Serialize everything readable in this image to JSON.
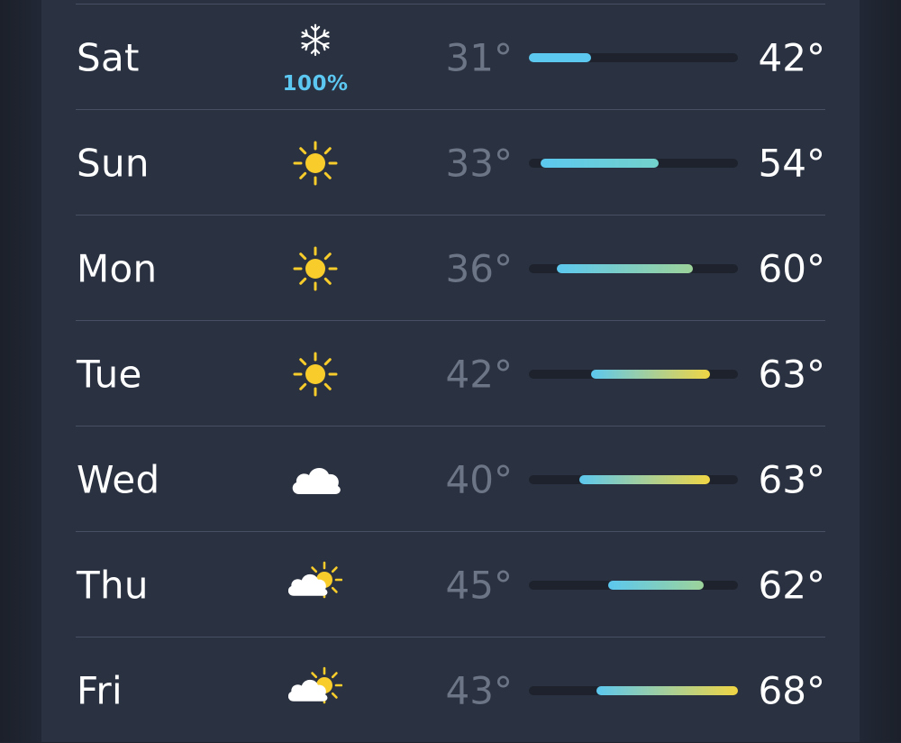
{
  "colors": {
    "precip_text": "#5cc8f2",
    "sun": "#f8cd2b",
    "cloud": "#ffffff",
    "low_temp_text": "#6c7585",
    "high_temp_text": "#ffffff",
    "track": "#1d222c"
  },
  "temperature_scale": {
    "min": 31,
    "max": 68
  },
  "forecast": [
    {
      "day": "Sat",
      "icon": "snowflake-icon",
      "precip": "100%",
      "low": "31°",
      "high": "42°",
      "low_value": 31,
      "high_value": 42
    },
    {
      "day": "Sun",
      "icon": "sun-icon",
      "precip": "",
      "low": "33°",
      "high": "54°",
      "low_value": 33,
      "high_value": 54
    },
    {
      "day": "Mon",
      "icon": "sun-icon",
      "precip": "",
      "low": "36°",
      "high": "60°",
      "low_value": 36,
      "high_value": 60
    },
    {
      "day": "Tue",
      "icon": "sun-icon",
      "precip": "",
      "low": "42°",
      "high": "63°",
      "low_value": 42,
      "high_value": 63
    },
    {
      "day": "Wed",
      "icon": "cloud-icon",
      "precip": "",
      "low": "40°",
      "high": "63°",
      "low_value": 40,
      "high_value": 63
    },
    {
      "day": "Thu",
      "icon": "partly-cloudy-icon",
      "precip": "",
      "low": "45°",
      "high": "62°",
      "low_value": 45,
      "high_value": 62
    },
    {
      "day": "Fri",
      "icon": "partly-cloudy-icon",
      "precip": "",
      "low": "43°",
      "high": "68°",
      "low_value": 43,
      "high_value": 68
    }
  ]
}
